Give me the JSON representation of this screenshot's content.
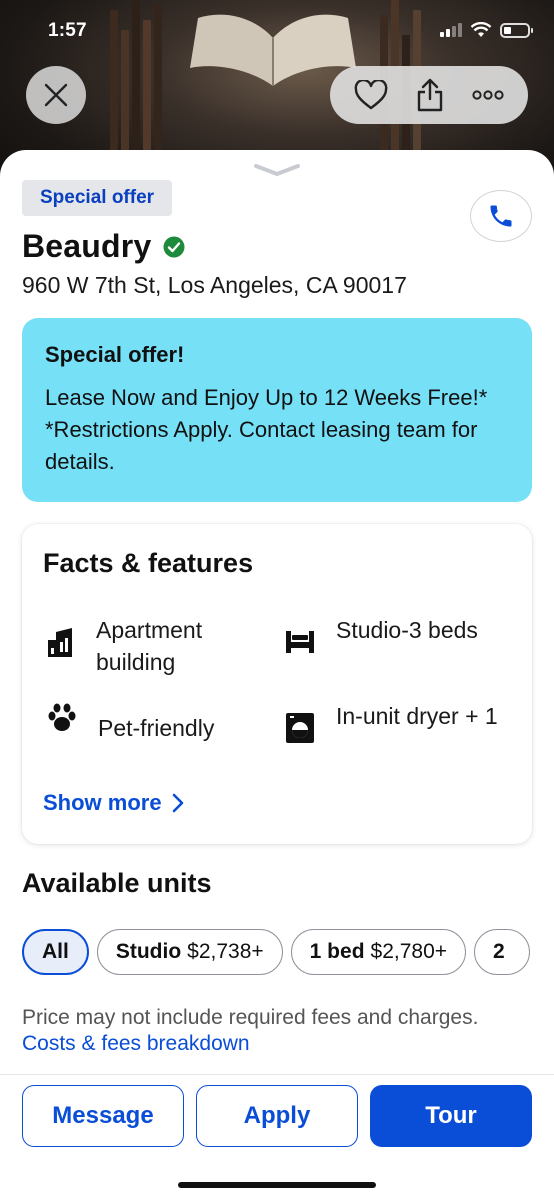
{
  "status_bar": {
    "time": "1:57"
  },
  "top_actions": {
    "close_icon": "close-icon",
    "favorite_icon": "heart-icon",
    "share_icon": "share-icon",
    "more_icon": "more-icon"
  },
  "listing": {
    "badge": "Special offer",
    "name": "Beaudry",
    "address": "960 W 7th St, Los Angeles, CA 90017"
  },
  "offer": {
    "title": "Special offer!",
    "text": "Lease Now and Enjoy Up to 12 Weeks Free!* *Restrictions Apply. Contact leasing team for details."
  },
  "facts": {
    "title": "Facts & features",
    "items": [
      {
        "icon": "building-icon",
        "label": "Apartment building"
      },
      {
        "icon": "bed-icon",
        "label": "Studio-3 beds"
      },
      {
        "icon": "paw-icon",
        "label": "Pet-friendly"
      },
      {
        "icon": "dryer-icon",
        "label": "In-unit dryer + 1"
      }
    ],
    "show_more": "Show more"
  },
  "units": {
    "title": "Available units",
    "chips": [
      {
        "bold": "All",
        "price": ""
      },
      {
        "bold": "Studio",
        "price": "$2,738+"
      },
      {
        "bold": "1 bed",
        "price": "$2,780+"
      },
      {
        "bold": "2",
        "price": ""
      }
    ],
    "fees_note": "Price may not include required fees and charges.",
    "fees_link": "Costs & fees breakdown"
  },
  "bottom_actions": {
    "message": "Message",
    "apply": "Apply",
    "tour": "Tour"
  },
  "colors": {
    "accent": "#0a4dd6",
    "offer_bg": "#76e0f7",
    "verified": "#1e8a3c"
  }
}
